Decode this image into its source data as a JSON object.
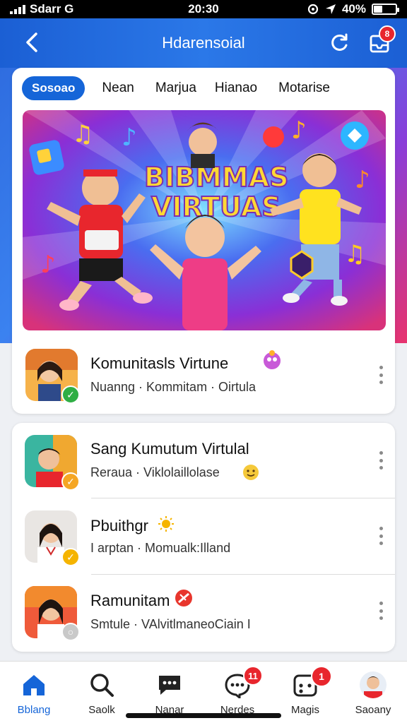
{
  "status_bar": {
    "carrier": "Sdarr G",
    "time": "20:30",
    "battery": "40%",
    "battery_level": 0.4
  },
  "header": {
    "title": "Hdarensoial",
    "notification_count": "8"
  },
  "tabs": [
    {
      "label": "Sosoao",
      "active": true
    },
    {
      "label": "Nean",
      "active": false
    },
    {
      "label": "Marjua",
      "active": false
    },
    {
      "label": "Hianao",
      "active": false
    },
    {
      "label": "Motarise",
      "active": false
    }
  ],
  "banner": {
    "headline_line1": "BIBMMAS",
    "headline_line2": "VIRTUAS"
  },
  "featured": {
    "title": "Komunitasls Virtune",
    "subtitle": "Nuanng · Kommitam · Oirtula"
  },
  "list": [
    {
      "title": "Sang Kumutum Virtulal",
      "subtitle": "Reraua · Viklolaillolase",
      "badge_color": "#f5a623"
    },
    {
      "title": "Pbuithgr",
      "subtitle": "I arptan · Momualk:Illand",
      "badge_color": "#f5b400"
    },
    {
      "title": "Ramunitam",
      "subtitle": "Smtule · VAlvitlmaneoCiain I",
      "badge_color": "#c9c9c9"
    }
  ],
  "bottom_nav": [
    {
      "label": "Bblang",
      "icon": "home-icon",
      "active": true,
      "badge": ""
    },
    {
      "label": "Saolk",
      "icon": "search-icon",
      "active": false,
      "badge": ""
    },
    {
      "label": "Nanar",
      "icon": "chat-icon",
      "active": false,
      "badge": ""
    },
    {
      "label": "Nerdes",
      "icon": "messages-icon",
      "active": false,
      "badge": "11"
    },
    {
      "label": "Magis",
      "icon": "games-icon",
      "active": false,
      "badge": "1"
    },
    {
      "label": "Saoany",
      "icon": "profile-avatar",
      "active": false,
      "badge": ""
    }
  ],
  "colors": {
    "primary": "#1565d8",
    "header": "#2b78e8",
    "badge": "#e8262d"
  }
}
